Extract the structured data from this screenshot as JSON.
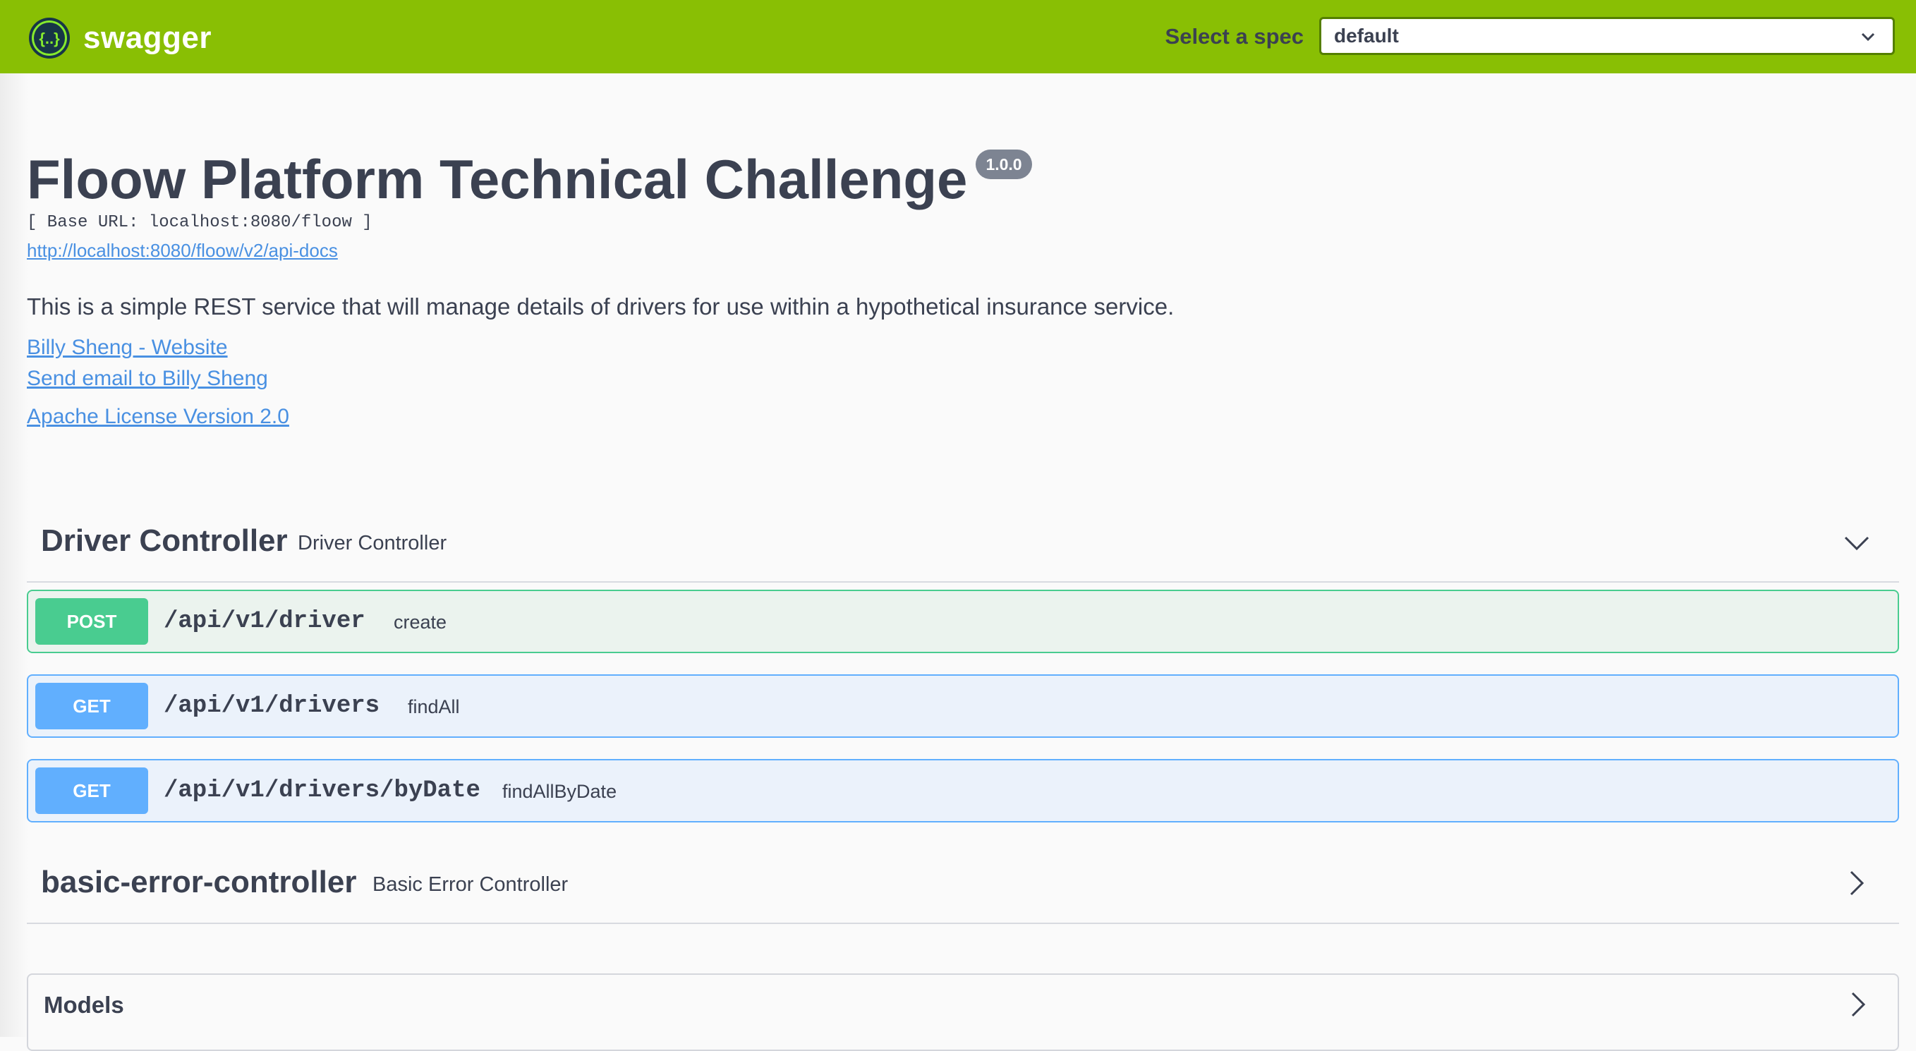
{
  "topbar": {
    "logo_text": "swagger",
    "spec_label": "Select a spec",
    "spec_value": "default"
  },
  "info": {
    "title": "Floow Platform Technical Challenge",
    "version": "1.0.0",
    "base_url": "[ Base URL: localhost:8080/floow ]",
    "api_docs_link": "http://localhost:8080/floow/v2/api-docs",
    "description": "This is a simple REST service that will manage details of drivers for use within a hypothetical insurance service.",
    "links": {
      "website": "Billy Sheng - Website",
      "email": "Send email to Billy Sheng",
      "license": "Apache License Version 2.0"
    }
  },
  "tags": [
    {
      "name": "Driver Controller",
      "description": "Driver Controller",
      "expanded": true,
      "operations": [
        {
          "method": "POST",
          "path": "/api/v1/driver",
          "summary": "create"
        },
        {
          "method": "GET",
          "path": "/api/v1/drivers",
          "summary": "findAll"
        },
        {
          "method": "GET",
          "path": "/api/v1/drivers/byDate",
          "summary": "findAllByDate"
        }
      ]
    },
    {
      "name": "basic-error-controller",
      "description": "Basic Error Controller",
      "expanded": false
    }
  ],
  "models": {
    "label": "Models"
  },
  "colors": {
    "topbar": "#89bf04",
    "post": "#49cc90",
    "get": "#61affe",
    "link": "#4990e2",
    "text": "#3b4151"
  }
}
